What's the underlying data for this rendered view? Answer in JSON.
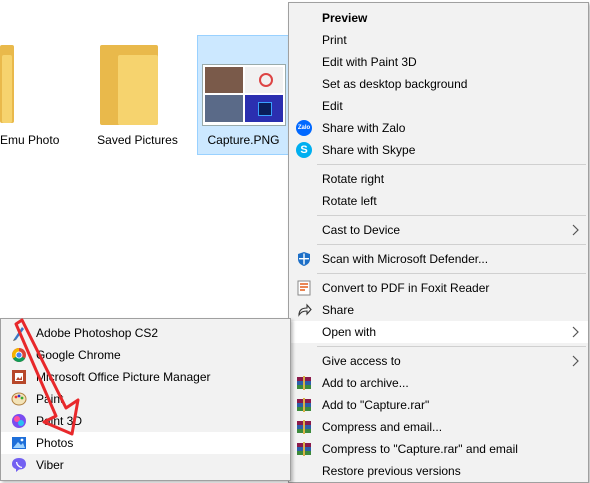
{
  "explorer": {
    "files": [
      {
        "label": "Emu Photo"
      },
      {
        "label": "Saved Pictures"
      },
      {
        "label": "Capture.PNG"
      }
    ]
  },
  "context_menu": {
    "items": [
      {
        "label": "Preview",
        "icon": ""
      },
      {
        "label": "Print",
        "icon": ""
      },
      {
        "label": "Edit with Paint 3D",
        "icon": ""
      },
      {
        "label": "Set as desktop background",
        "icon": ""
      },
      {
        "label": "Edit",
        "icon": ""
      },
      {
        "label": "Share with Zalo",
        "icon": "zalo-icon",
        "icon_text": "Zalo"
      },
      {
        "label": "Share with Skype",
        "icon": "skype-icon",
        "icon_text": "S"
      },
      {
        "label": "Rotate right",
        "icon": ""
      },
      {
        "label": "Rotate left",
        "icon": ""
      },
      {
        "label": "Cast to Device",
        "icon": ""
      },
      {
        "label": "Scan with Microsoft Defender...",
        "icon": "defender-icon"
      },
      {
        "label": "Convert to PDF in Foxit Reader",
        "icon": "foxit-icon"
      },
      {
        "label": "Share",
        "icon": "share-icon"
      },
      {
        "label": "Open with",
        "icon": ""
      },
      {
        "label": "Give access to",
        "icon": ""
      },
      {
        "label": "Add to archive...",
        "icon": "winrar-icon"
      },
      {
        "label": "Add to \"Capture.rar\"",
        "icon": "winrar-icon"
      },
      {
        "label": "Compress and email...",
        "icon": "winrar-icon"
      },
      {
        "label": "Compress to \"Capture.rar\" and email",
        "icon": "winrar-icon"
      },
      {
        "label": "Restore previous versions",
        "icon": ""
      }
    ]
  },
  "open_with_menu": {
    "items": [
      {
        "label": "Adobe Photoshop CS2",
        "icon": "photoshop-icon"
      },
      {
        "label": "Google Chrome",
        "icon": "chrome-icon"
      },
      {
        "label": "Microsoft Office Picture Manager",
        "icon": "picture-manager-icon"
      },
      {
        "label": "Paint",
        "icon": "paint-icon"
      },
      {
        "label": "Paint 3D",
        "icon": "paint3d-icon"
      },
      {
        "label": "Photos",
        "icon": "photos-icon"
      },
      {
        "label": "Viber",
        "icon": "viber-icon"
      }
    ]
  },
  "colors": {
    "menu_bg": "#F2F2F2",
    "menu_hover": "#FFFFFF",
    "selection": "#CCE8FF",
    "arrow": "#E8282B",
    "winrar": "#8B1A4A",
    "skype": "#00AFF0",
    "zalo": "#0068FF"
  }
}
